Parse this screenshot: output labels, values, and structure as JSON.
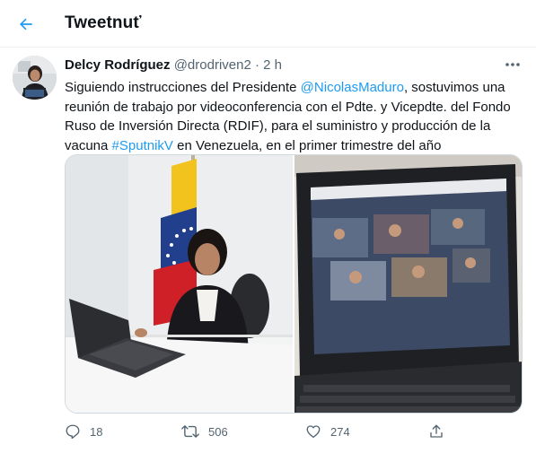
{
  "header": {
    "title": "Tweetnuť"
  },
  "tweet": {
    "author_name": "Delcy Rodríguez",
    "author_handle": "@drodriven2",
    "separator": "·",
    "time": "2 h",
    "text_segments": [
      {
        "text": "Siguiendo instrucciones del Presidente ",
        "link": false
      },
      {
        "text": "@NicolasMaduro",
        "link": true
      },
      {
        "text": ", sostuvimos una reunión de trabajo por videoconferencia con el Pdte. y Vicepdte. del Fondo Ruso de Inversión Directa (RDIF), para el suministro y producción de la vacuna ",
        "link": false
      },
      {
        "text": "#SputnikV",
        "link": true
      },
      {
        "text": " en Venezuela, en el primer trimestre del año",
        "link": false
      }
    ],
    "media": [
      {
        "icon": "photo-woman-laptop-flag"
      },
      {
        "icon": "photo-laptop-videoconference"
      }
    ]
  },
  "actions": {
    "reply_count": "18",
    "retweet_count": "506",
    "like_count": "274"
  },
  "colors": {
    "accent": "#1d9bf0",
    "secondary_text": "#536471",
    "border": "#eff3f4"
  }
}
